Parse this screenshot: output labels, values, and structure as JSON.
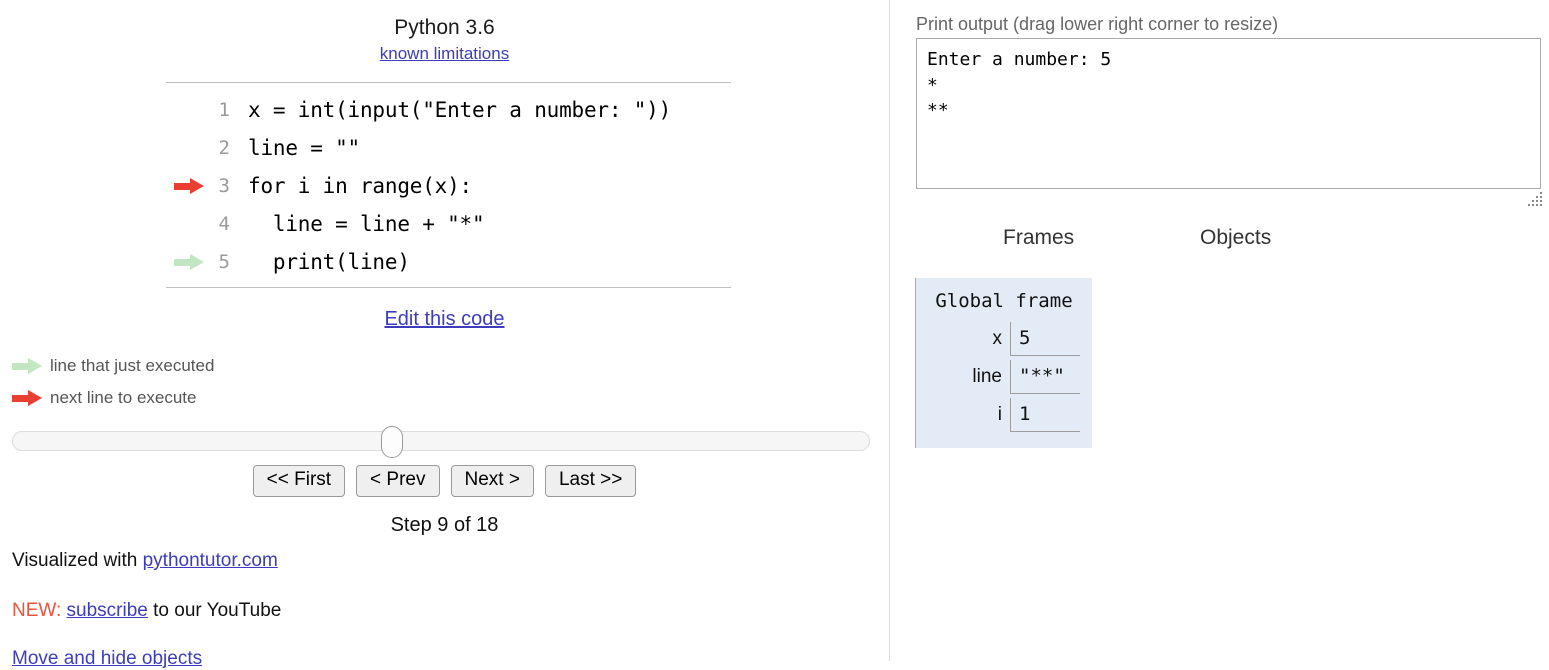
{
  "left": {
    "python_version": "Python 3.6",
    "known_limitations_link": "known limitations",
    "code_lines": [
      {
        "number": "1",
        "text": "x = int(input(\"Enter a number: \"))",
        "arrow": "none"
      },
      {
        "number": "2",
        "text": "line = \"\"",
        "arrow": "none"
      },
      {
        "number": "3",
        "text": "for i in range(x):",
        "arrow": "red"
      },
      {
        "number": "4",
        "text": "  line = line + \"*\"",
        "arrow": "none"
      },
      {
        "number": "5",
        "text": "  print(line)",
        "arrow": "green"
      }
    ],
    "edit_code_link": "Edit this code",
    "legend": [
      {
        "arrow": "green",
        "label": "line that just executed"
      },
      {
        "arrow": "red",
        "label": "next line to execute"
      }
    ],
    "nav_buttons": [
      "<< First",
      "< Prev",
      "Next >",
      "Last >>"
    ],
    "slider_position_percent": 44,
    "step_counter": "Step 9 of 18",
    "footer": {
      "visualized_prefix": "Visualized with ",
      "visualized_link": "pythontutor.com",
      "new_tag": "NEW:",
      "subscribe_link": "subscribe",
      "subscribe_suffix": " to our YouTube",
      "move_hide_link": "Move and hide objects"
    }
  },
  "right": {
    "print_output_label": "Print output (drag lower right corner to resize)",
    "print_output_text": "Enter a number: 5\n*\n**",
    "frames_header": "Frames",
    "objects_header": "Objects",
    "global_frame": {
      "title": "Global frame",
      "variables": [
        {
          "name": "x",
          "value": "5"
        },
        {
          "name": "line",
          "value": "\"**\""
        },
        {
          "name": "i",
          "value": "1"
        }
      ]
    }
  },
  "colors": {
    "next_line_arrow": "#e93f33",
    "executed_line_arrow": "#c2e6c2",
    "frame_background": "#e2ebf6",
    "link": "#3d3dbb",
    "new_tag": "#e8543f"
  }
}
